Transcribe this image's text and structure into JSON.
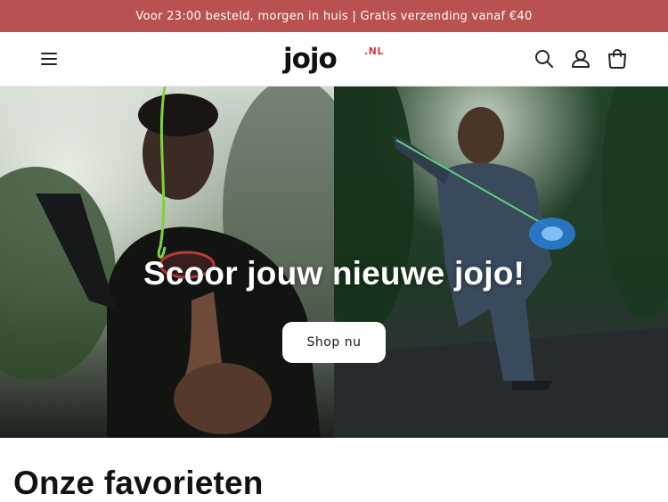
{
  "announcement": {
    "text": "Voor 23:00 besteld, morgen in huis | Gratis verzending vanaf €40"
  },
  "header": {
    "menu_icon": "hamburger-menu-icon",
    "logo": {
      "main": "jojo",
      "suffix": ".NL",
      "suffix_color": "#d23b3b"
    },
    "icons": [
      "search-icon",
      "account-icon",
      "cart-icon"
    ]
  },
  "hero": {
    "heading": "Scoor jouw nieuwe jojo!",
    "button_label": "Shop nu"
  },
  "featured": {
    "title": "Onze favorieten"
  },
  "colors": {
    "announcement_bg": "#b85150",
    "announcement_text": "#ffffff",
    "hero_text": "#ffffff",
    "button_bg": "#ffffff"
  }
}
